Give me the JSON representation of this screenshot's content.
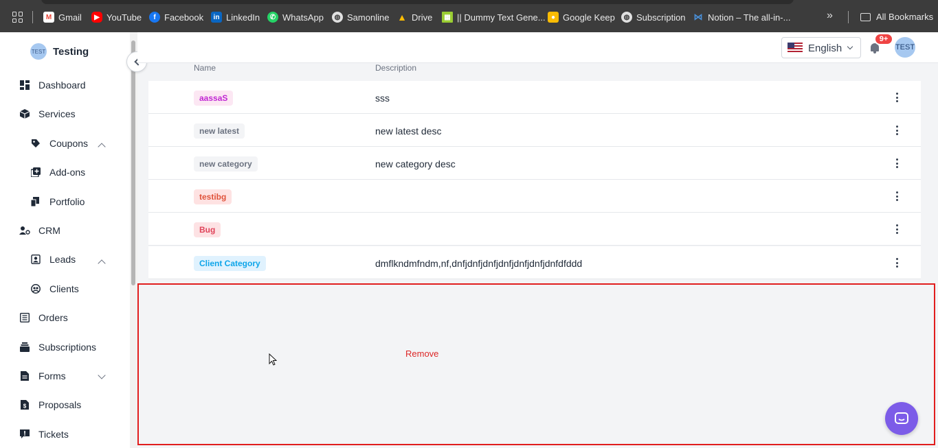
{
  "bookmarks_bar": {
    "items": [
      {
        "label": "Gmail",
        "icon": "gmail-icon",
        "color": "#ea4335"
      },
      {
        "label": "YouTube",
        "icon": "youtube-icon",
        "color": "#ff0000"
      },
      {
        "label": "Facebook",
        "icon": "facebook-icon",
        "color": "#1877f2"
      },
      {
        "label": "LinkedIn",
        "icon": "linkedin-icon",
        "color": "#0a66c2"
      },
      {
        "label": "WhatsApp",
        "icon": "whatsapp-icon",
        "color": "#25d366"
      },
      {
        "label": "Samonline",
        "icon": "globe-icon",
        "color": "#e0e0e0"
      },
      {
        "label": "Drive",
        "icon": "drive-icon",
        "color": "#1fa463"
      },
      {
        "label": "|| Dummy Text Gene...",
        "icon": "dummy-text-icon",
        "color": "#9acd32"
      },
      {
        "label": "Google Keep",
        "icon": "keep-icon",
        "color": "#fbbc04"
      },
      {
        "label": "Subscription",
        "icon": "globe-icon",
        "color": "#e0e0e0"
      },
      {
        "label": "Notion – The all-in-...",
        "icon": "notion-icon",
        "color": "#4a90d9"
      }
    ],
    "all_bookmarks_label": "All Bookmarks"
  },
  "sidebar": {
    "workspace": {
      "avatar_text": "TEST",
      "name": "Testing"
    },
    "items": [
      {
        "label": "Dashboard",
        "icon": "dashboard-icon"
      },
      {
        "label": "Services",
        "icon": "box-icon",
        "expanded": true
      },
      {
        "label": "Coupons",
        "icon": "tag-icon",
        "sub": true
      },
      {
        "label": "Add-ons",
        "icon": "add-square-icon",
        "sub": true
      },
      {
        "label": "Portfolio",
        "icon": "portfolio-icon",
        "sub": true
      },
      {
        "label": "CRM",
        "icon": "crm-icon",
        "expanded": true
      },
      {
        "label": "Leads",
        "icon": "lead-icon",
        "sub": true
      },
      {
        "label": "Clients",
        "icon": "clients-icon",
        "sub": true
      },
      {
        "label": "Orders",
        "icon": "orders-icon"
      },
      {
        "label": "Subscriptions",
        "icon": "subscriptions-icon"
      },
      {
        "label": "Forms",
        "icon": "forms-icon",
        "expanded": false
      },
      {
        "label": "Proposals",
        "icon": "proposals-icon"
      },
      {
        "label": "Tickets",
        "icon": "tickets-icon"
      }
    ]
  },
  "topbar": {
    "language": "English",
    "notification_count": "9+",
    "avatar_text": "TEST"
  },
  "table": {
    "columns": [
      "Name",
      "Description"
    ],
    "rows": [
      {
        "name": "aassaS",
        "description": "sss",
        "tag_bg": "#fce7f3",
        "tag_color": "#c026d3"
      },
      {
        "name": "new latest",
        "description": "new latest desc",
        "tag_bg": "#f3f4f6",
        "tag_color": "#6b7280"
      },
      {
        "name": "new category",
        "description": "new category desc",
        "tag_bg": "#f3f4f6",
        "tag_color": "#6b7280"
      },
      {
        "name": "testibg",
        "description": "",
        "tag_bg": "#fee2e2",
        "tag_color": "#e0533b"
      },
      {
        "name": "Bug",
        "description": "",
        "tag_bg": "#fde2e4",
        "tag_color": "#e0445a"
      },
      {
        "name": "Client Category",
        "description": "dmflkndmfndm,nf,dnfjdnfjdnfjdnfjdnfjdnfjdnfdfddd",
        "tag_bg": "#e0f2fe",
        "tag_color": "#0ea5e9"
      }
    ]
  },
  "drop_zone": {
    "label": "Remove",
    "border_color": "#e11d1d"
  },
  "chat_widget": {
    "icon": "chat-icon",
    "color": "#7c5ce8"
  }
}
